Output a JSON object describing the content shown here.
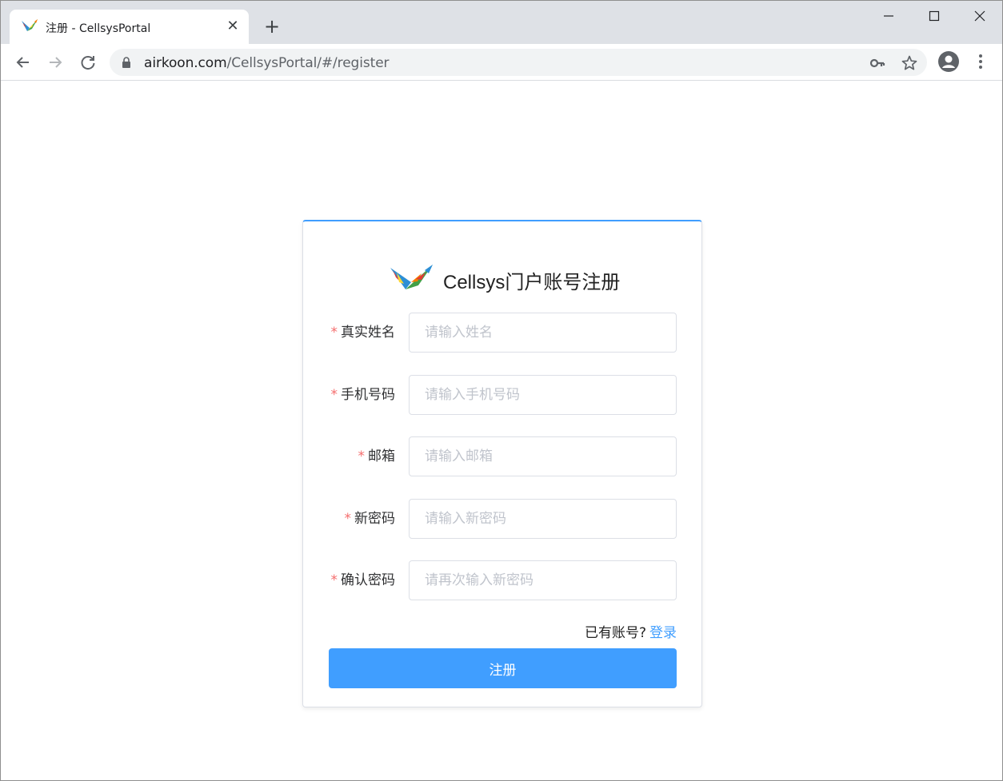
{
  "browser": {
    "tab": {
      "title": "注册 - CellsysPortal",
      "close_icon": "close-icon"
    },
    "new_tab_icon": "plus-icon",
    "window_controls": [
      "minimize-icon",
      "maximize-icon",
      "close-icon"
    ],
    "url": {
      "host": "airkoon.com",
      "path": "/CellsysPortal/#/register"
    }
  },
  "page": {
    "title": "Cellsys门户账号注册",
    "fields": [
      {
        "label": "真实姓名",
        "required_mark": "*",
        "placeholder": "请输入姓名",
        "value": ""
      },
      {
        "label": "手机号码",
        "required_mark": "*",
        "placeholder": "请输入手机号码",
        "value": ""
      },
      {
        "label": "邮箱",
        "required_mark": "*",
        "placeholder": "请输入邮箱",
        "value": ""
      },
      {
        "label": "新密码",
        "required_mark": "*",
        "placeholder": "请输入新密码",
        "value": ""
      },
      {
        "label": "确认密码",
        "required_mark": "*",
        "placeholder": "请再次输入新密码",
        "value": ""
      }
    ],
    "login_prompt": "已有账号?",
    "login_link": "登录",
    "submit_label": "注册"
  },
  "colors": {
    "primary": "#409eff",
    "required": "#f56c6c",
    "tabstrip": "#dee1e6"
  }
}
